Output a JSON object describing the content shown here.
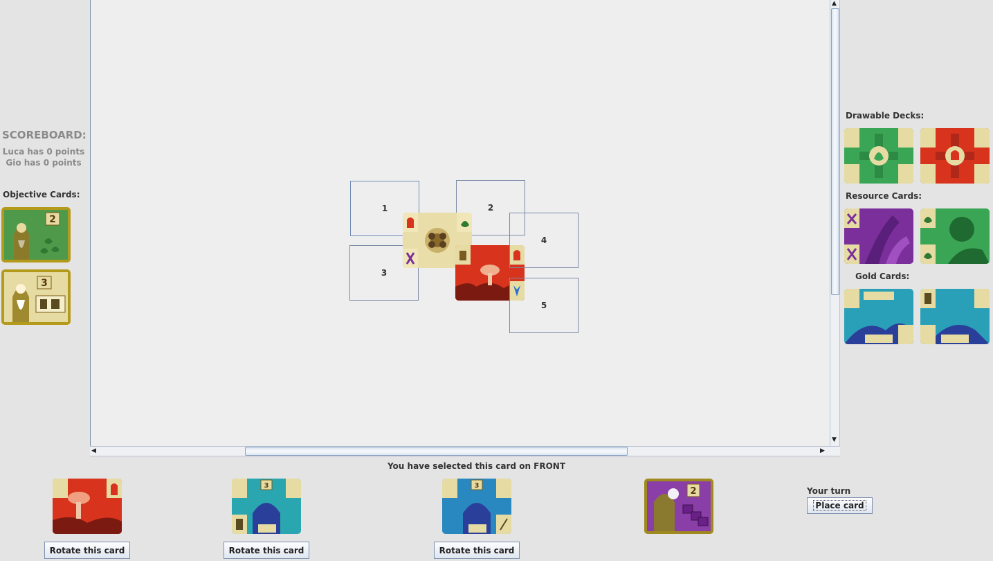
{
  "scoreboard": {
    "title": "SCOREBOARD:",
    "players": [
      {
        "text": "Luca has 0 points"
      },
      {
        "text": "Gio has 0 points"
      }
    ]
  },
  "objectives": {
    "title": "Objective Cards:",
    "cards": [
      {
        "icon": "objective-card-leaves-icon",
        "points": "2"
      },
      {
        "icon": "objective-card-items-icon",
        "points": "3"
      }
    ]
  },
  "board": {
    "slots": [
      "1",
      "2",
      "3",
      "4",
      "5"
    ]
  },
  "right_panel": {
    "drawable_title": "Drawable Decks:",
    "resource_title": "Resource Cards:",
    "gold_title": "Gold Cards:"
  },
  "hand": {
    "selected_message": "You have selected this card on FRONT",
    "rotate_label": "Rotate this card",
    "cards": [
      {
        "icon": "red-fungi-card-icon"
      },
      {
        "icon": "blue-gold-card-scroll-icon",
        "points": "3"
      },
      {
        "icon": "blue-gold-card-quill-icon",
        "points": "3"
      },
      {
        "icon": "purple-objective-card-icon",
        "points": "2"
      }
    ]
  },
  "turn": {
    "label": "Your turn",
    "place_label": "Place card"
  },
  "colors": {
    "board_bg": "#eeeeee",
    "panel_bg": "#e4e4e4",
    "fungi_red": "#d8331c",
    "plant_green": "#3aa655",
    "insect_purple": "#7a2f9a",
    "animal_blue": "#2a8fb0",
    "corner_cream": "#e6dca3"
  }
}
